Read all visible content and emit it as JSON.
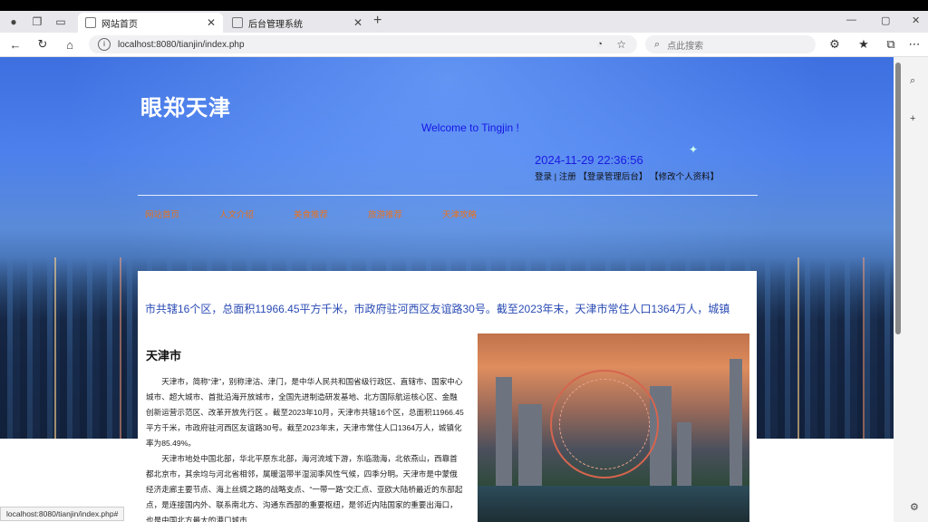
{
  "browser": {
    "tabs": [
      {
        "title": "网站首页",
        "active": true
      },
      {
        "title": "后台管理系统",
        "active": false
      }
    ],
    "address": "localhost:8080/tianjin/index.php",
    "search_placeholder": "点此搜索",
    "status_url": "localhost:8080/tianjin/index.php#"
  },
  "site": {
    "logo": "眼郑天津",
    "welcome": "Welcome to Tingjin !",
    "datetime": "2024-11-29 22:36:56",
    "links": {
      "login": "登录",
      "sep": " | ",
      "register": "注册",
      "admin": "【登录管理后台】",
      "profile": "【修改个人资料】"
    },
    "nav": [
      "网站首页",
      "人文介绍",
      "美食推荐",
      "旅游推荐",
      "天津攻略"
    ]
  },
  "content": {
    "marquee": "市共辖16个区，总面积11966.45平方千米，市政府驻河西区友谊路30号。截至2023年末，天津市常住人口1364万人，城镇",
    "title": "天津市",
    "paragraphs": [
      "天津市，简称“津”，别称津沽、津门，是中华人民共和国省级行政区、直辖市、国家中心城市、超大城市、首批沿海开放城市，全国先进制造研发基地、北方国际航运核心区、金融创新运营示范区、改革开放先行区 。截至2023年10月，天津市共辖16个区，总面积11966.45平方千米，市政府驻河西区友谊路30号。截至2023年末，天津市常住人口1364万人，城镇化率为85.49%。",
      "天津市地处中国北部，华北平原东北部，海河流域下游，东临渤海，北依燕山，西靠首都北京市，其余均与河北省相邻，属暖温带半湿润季风性气候，四季分明。天津市是中蒙俄经济走廊主要节点、海上丝绸之路的战略支点、“一带一路”交汇点、亚欧大陆桥最近的东部起点，是连接国内外、联系南北方、沟通东西部的重要枢纽，是邻近内陆国家的重要出海口，也是中国北方最大的港口城市"
    ]
  }
}
